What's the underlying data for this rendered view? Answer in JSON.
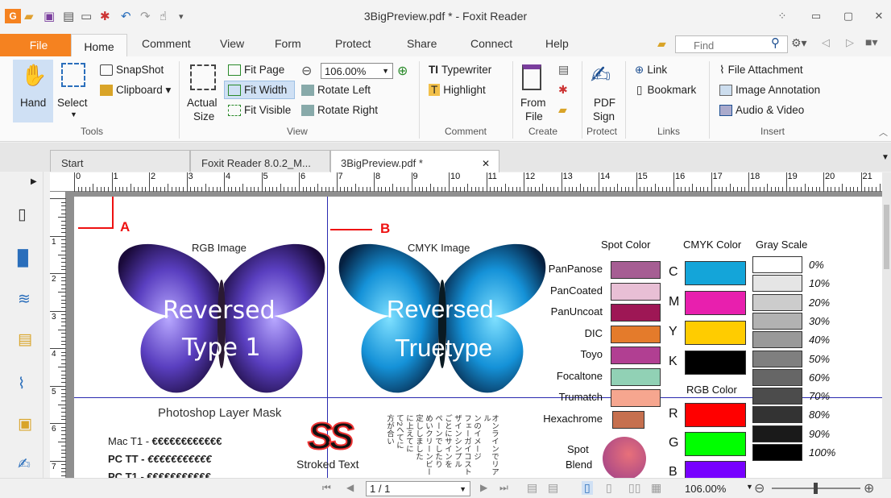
{
  "app": {
    "title": "3BigPreview.pdf * - Foxit Reader"
  },
  "menu": {
    "file": "File",
    "tabs": [
      "Home",
      "Comment",
      "View",
      "Form",
      "Protect",
      "Share",
      "Connect",
      "Help"
    ]
  },
  "search": {
    "placeholder": "Find"
  },
  "ribbon": {
    "tools": {
      "hand": "Hand",
      "select": "Select",
      "snapshot": "SnapShot",
      "clipboard": "Clipboard",
      "group": "Tools"
    },
    "view": {
      "actual1": "Actual",
      "actual2": "Size",
      "fit_page": "Fit Page",
      "fit_width": "Fit Width",
      "fit_visible": "Fit Visible",
      "zoom": "106.00%",
      "rotate_left": "Rotate Left",
      "rotate_right": "Rotate Right",
      "group": "View"
    },
    "comment": {
      "typewriter": "Typewriter",
      "highlight": "Highlight",
      "group": "Comment"
    },
    "create": {
      "from1": "From",
      "from2": "File",
      "group": "Create"
    },
    "protect": {
      "pdf": "PDF",
      "sign": "Sign",
      "group": "Protect"
    },
    "links": {
      "link": "Link",
      "bookmark": "Bookmark",
      "group": "Links"
    },
    "insert": {
      "file_attachment": "File Attachment",
      "image_annotation": "Image Annotation",
      "audio_video": "Audio & Video",
      "group": "Insert"
    }
  },
  "doc_tabs": [
    "Start",
    "Foxit Reader 8.0.2_M...",
    "3BigPreview.pdf *"
  ],
  "ruler": [
    "0",
    "1",
    "2",
    "3",
    "4",
    "5",
    "6",
    "7",
    "8",
    "9",
    "10",
    "11",
    "12",
    "13",
    "14",
    "15",
    "16",
    "17",
    "18",
    "19",
    "20",
    "21"
  ],
  "vruler": [
    "1",
    "2",
    "3",
    "4",
    "5",
    "6",
    "7"
  ],
  "page": {
    "mark_a": "A",
    "mark_b": "B",
    "rgb_caption": "RGB Image",
    "cmyk_caption": "CMYK Image",
    "rev1_line1": "Reversed",
    "rev1_line2": "Type 1",
    "rev2_line1": "Reversed",
    "rev2_line2": "Truetype",
    "layer_mask": "Photoshop Layer Mask",
    "mac_t1_label": "Mac T1 - ",
    "mac_t1_euro": "€€€€€€€€€€€€",
    "pc_tt_label": "PC TT - ",
    "pc_tt_euro": "€€€€€€€€€€€",
    "pc_t1_label": "PC T1 - ",
    "pc_t1_euro": "€€€€€€€€€€€",
    "ss": "SS",
    "stroked": "Stroked Text",
    "vertical_cols": [
      "オンラインでリアル",
      "ンのイメージ",
      "フェーガイコスト",
      "ザインシンプル",
      "ごとにサインを",
      "ペーンでしたり",
      "めいクリーンビー",
      "定ししました",
      "に上えてに",
      "て2ヘてに",
      "方が合い"
    ],
    "spot_header": "Spot Color",
    "cmyk_header": "CMYK Color",
    "gray_header": "Gray Scale",
    "rgb_header": "RGB Color",
    "spot_names": [
      "PanPanose",
      "PanCoated",
      "PanUncoat",
      "DIC",
      "Toyo",
      "Focaltone",
      "Trumatch",
      "Hexachrome"
    ],
    "spot_colors": [
      "#a65e93",
      "#e8bfd5",
      "#9e1755",
      "#e47b2b",
      "#b13f92",
      "#91d1b5",
      "#f6a68f",
      "#c6704f"
    ],
    "cmyk_letters": [
      "C",
      "M",
      "Y",
      "K"
    ],
    "cmyk_colors": [
      "#14a5d9",
      "#e81fae",
      "#ffcc00",
      "#000000"
    ],
    "rgb_letters": [
      "R",
      "G",
      "B"
    ],
    "rgb_colors": [
      "#ff0000",
      "#00ff00",
      "#7700ff"
    ],
    "gray_values": [
      "0%",
      "10%",
      "20%",
      "30%",
      "40%",
      "50%",
      "60%",
      "70%",
      "80%",
      "90%",
      "100%"
    ],
    "gray_colors": [
      "#ffffff",
      "#e5e5e5",
      "#cccccc",
      "#b2b2b2",
      "#999999",
      "#7f7f7f",
      "#666666",
      "#4c4c4c",
      "#333333",
      "#1a1a1a",
      "#000000"
    ],
    "spot_blend1": "Spot",
    "spot_blend2": "Blend"
  },
  "status": {
    "page": "1 / 1",
    "zoom": "106.00%"
  }
}
